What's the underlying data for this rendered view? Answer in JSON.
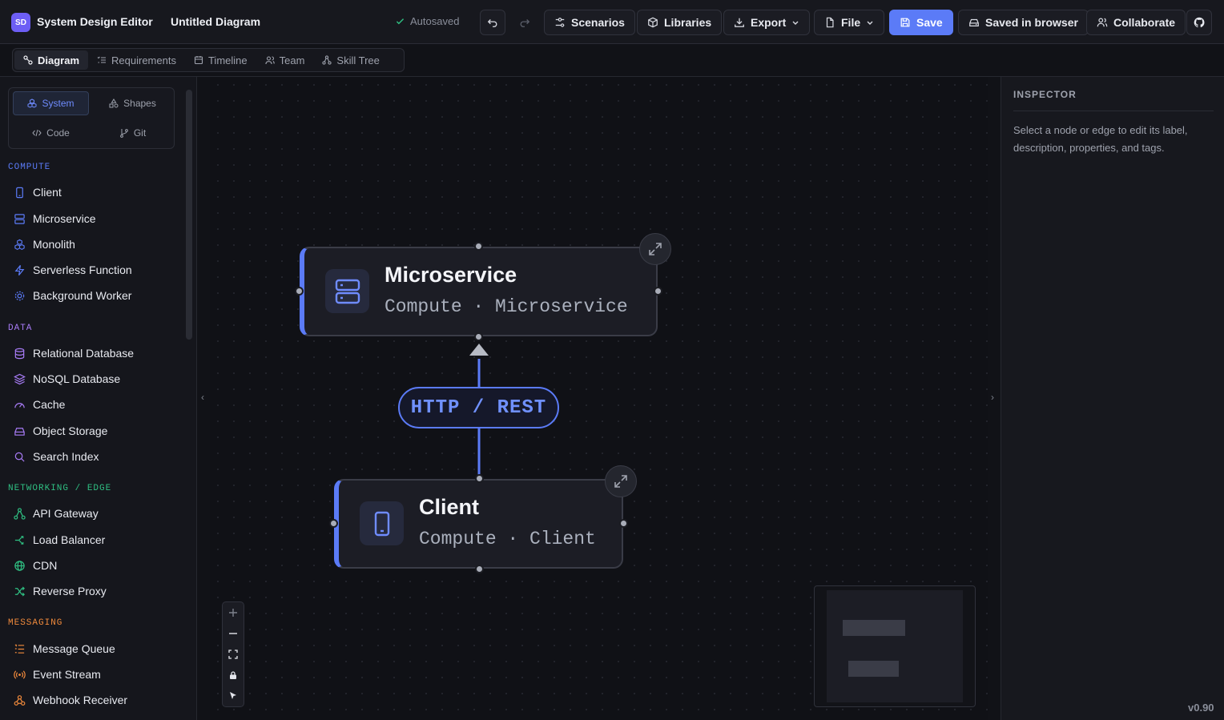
{
  "app": {
    "logo": "SD",
    "name": "System Design Editor",
    "doc_title": "Untitled Diagram",
    "autosave_status": "Autosaved",
    "version": "v0.90"
  },
  "toolbar": {
    "scenarios": "Scenarios",
    "libraries": "Libraries",
    "export": "Export",
    "file": "File",
    "save": "Save",
    "saved_browser": "Saved in browser",
    "collaborate": "Collaborate"
  },
  "tabs": [
    "Diagram",
    "Requirements",
    "Timeline",
    "Team",
    "Skill Tree"
  ],
  "palette": {
    "system": "System",
    "shapes": "Shapes",
    "code": "Code",
    "git": "Git"
  },
  "sections": {
    "compute": {
      "title": "COMPUTE",
      "color": "#5b7bf7",
      "items": [
        "Client",
        "Microservice",
        "Monolith",
        "Serverless Function",
        "Background Worker"
      ]
    },
    "data": {
      "title": "DATA",
      "color": "#a77bf5",
      "items": [
        "Relational Database",
        "NoSQL Database",
        "Cache",
        "Object Storage",
        "Search Index"
      ]
    },
    "networking": {
      "title": "NETWORKING / EDGE",
      "color": "#2fbf82",
      "items": [
        "API Gateway",
        "Load Balancer",
        "CDN",
        "Reverse Proxy"
      ]
    },
    "messaging": {
      "title": "MESSAGING",
      "color": "#f08a3c",
      "items": [
        "Message Queue",
        "Event Stream",
        "Webhook Receiver"
      ]
    }
  },
  "canvas": {
    "nodes": [
      {
        "title": "Microservice",
        "subtitle": "Compute · Microservice"
      },
      {
        "title": "Client",
        "subtitle": "Compute · Client"
      }
    ],
    "edge_label": "HTTP / REST"
  },
  "inspector": {
    "title": "INSPECTOR",
    "hint": "Select a node or edge to edit its label, description, properties, and tags."
  }
}
